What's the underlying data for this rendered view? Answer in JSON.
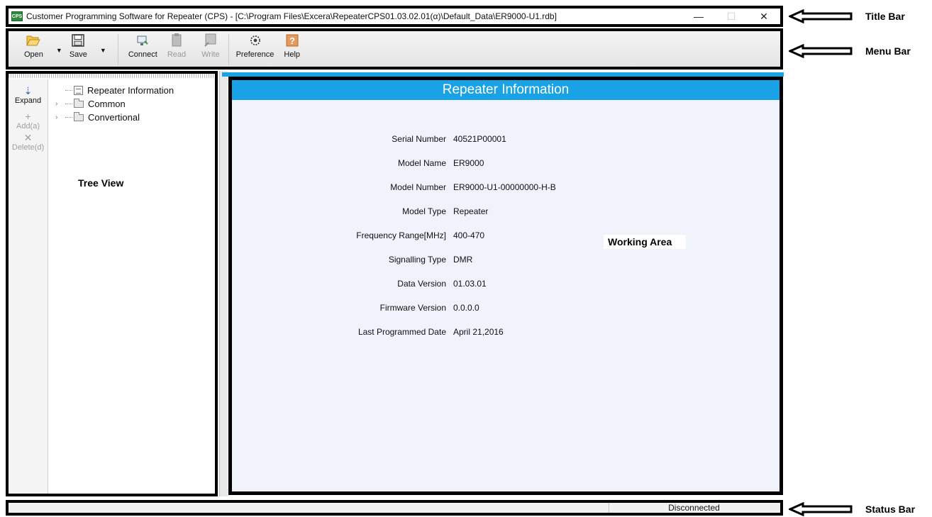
{
  "titlebar": {
    "app_icon_text": "CPS",
    "title": "Customer Programming Software for Repeater (CPS) - [C:\\Program Files\\Excera\\RepeaterCPS01.03.02.01(α)\\Default_Data\\ER9000-U1.rdb]",
    "minimize": "—",
    "maximize": "☐",
    "close": "✕"
  },
  "toolbar": {
    "open": "Open",
    "save": "Save",
    "connect": "Connect",
    "read": "Read",
    "write": "Write",
    "preference": "Preference",
    "help": "Help"
  },
  "tree_side": {
    "expand": "Expand",
    "add": "Add(a)",
    "delete": "Delete(d)"
  },
  "tree": {
    "items": [
      {
        "label": "Repeater Information"
      },
      {
        "label": "Common"
      },
      {
        "label": "Convertional"
      }
    ]
  },
  "annotations": {
    "tree_view": "Tree View",
    "working_area": "Working Area",
    "title_bar": "Title Bar",
    "menu_bar": "Menu Bar",
    "status_bar": "Status Bar"
  },
  "work_area": {
    "header": "Repeater Information",
    "rows": [
      {
        "label": "Serial Number",
        "value": "40521P00001"
      },
      {
        "label": "Model Name",
        "value": "ER9000"
      },
      {
        "label": "Model Number",
        "value": "ER9000-U1-00000000-H-B"
      },
      {
        "label": "Model Type",
        "value": "Repeater"
      },
      {
        "label": "Frequency Range[MHz]",
        "value": "400-470"
      },
      {
        "label": "Signalling Type",
        "value": "DMR"
      },
      {
        "label": "Data Version",
        "value": "01.03.01"
      },
      {
        "label": "Firmware Version",
        "value": "0.0.0.0"
      },
      {
        "label": "Last Programmed Date",
        "value": "April 21,2016"
      }
    ]
  },
  "statusbar": {
    "connection": "Disconnected"
  },
  "colors": {
    "accent": "#1aa2e6",
    "work_bg": "#f0f2fc"
  }
}
